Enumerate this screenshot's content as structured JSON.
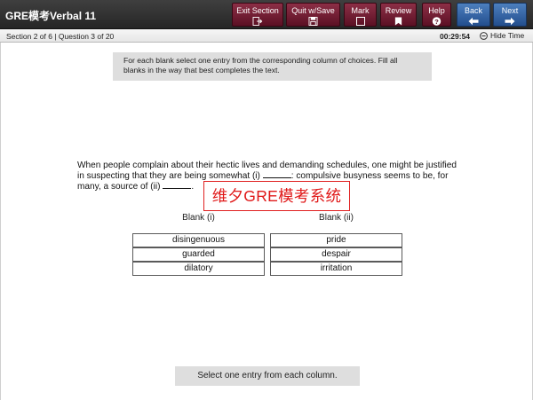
{
  "app": {
    "title": "GRE模考Verbal 11"
  },
  "toolbar": {
    "exit_section": "Exit Section",
    "quit_save": "Quit w/Save",
    "mark": "Mark",
    "review": "Review",
    "help": "Help",
    "back": "Back",
    "next": "Next"
  },
  "status": {
    "section_info": "Section 2 of 6 | Question 3 of 20",
    "timer": "00:29:54",
    "hide_time": "Hide Time"
  },
  "instructions": "For each blank select one entry from the corresponding column of choices. Fill all blanks in the way that best completes the text.",
  "question": {
    "part1": "When people complain about their hectic lives and demanding schedules, one might be justified in suspecting that they are being somewhat (i)",
    "part2": ": compulsive busyness seems to be, for many, a source of (ii)",
    "part3": "."
  },
  "watermark": "维夕GRE模考系统",
  "blanks": {
    "i": {
      "label": "Blank (i)",
      "choices": [
        "disingenuous",
        "guarded",
        "dilatory"
      ]
    },
    "ii": {
      "label": "Blank (ii)",
      "choices": [
        "pride",
        "despair",
        "irritation"
      ]
    }
  },
  "footer_message": "Select one entry from each column.",
  "colors": {
    "toolbar_bg": "#2f2f2f",
    "maroon_button": "#7a2238",
    "blue_button": "#3565a8",
    "watermark_red": "#e01818"
  }
}
